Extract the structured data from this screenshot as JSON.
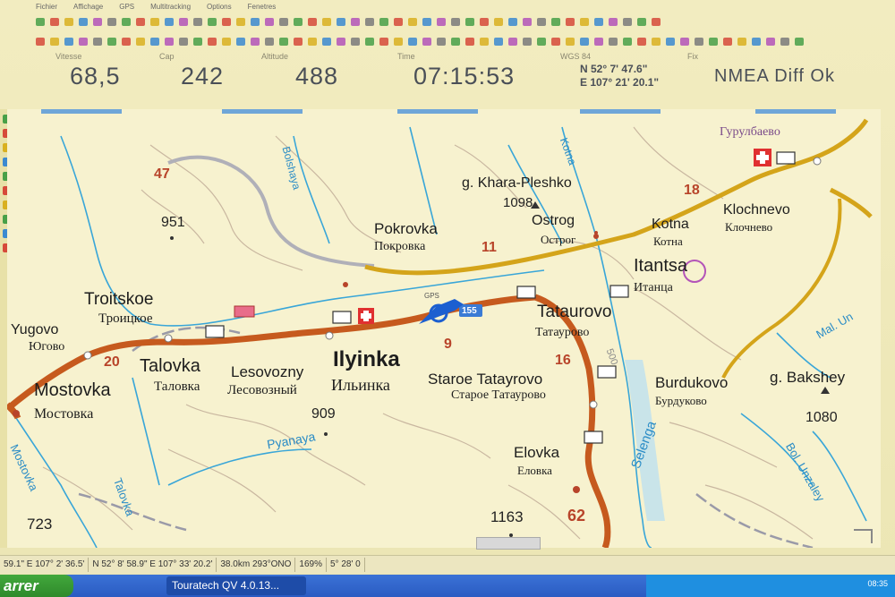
{
  "menu": [
    "Fichier",
    "Affichage",
    "GPS",
    "Multitracking",
    "Options",
    "Fenetres"
  ],
  "readouts": {
    "speed_label": "Vitesse",
    "speed": "68,5",
    "cap_label": "Cap",
    "cap": "242",
    "altitude_label": "Altitude",
    "altitude": "488",
    "time_label": "Time",
    "time": "07:15:53",
    "datum_label": "WGS 84",
    "lat": "N 52° 7' 47.6\"",
    "lon": "E 107° 21' 20.1\"",
    "fix_label": "Fix",
    "fix": "NMEA Diff Ok"
  },
  "map": {
    "places": {
      "troitskoe": "Troitskoe",
      "troitskoe_ru": "Троицкое",
      "yugovo": "Yugovo",
      "yugovo_ru": "Югово",
      "mostovka": "Mostovka",
      "mostovka_ru": "Мостовка",
      "talovka": "Talovka",
      "talovka_ru": "Таловка",
      "lesovozny": "Lesovozny",
      "lesovozny_ru": "Лесовозный",
      "ilyinka": "Ilyinka",
      "ilyinka_ru": "Ильинка",
      "staroe": "Staroe Tatayrovo",
      "staroe_ru": "Старое Татаурово",
      "tataurovo": "Tataurovo",
      "tataurovo_ru": "Татаурово",
      "pokrovka": "Pokrovka",
      "pokrovka_ru": "Покровка",
      "ostrog": "Ostrog",
      "ostrog_ru": "Острог",
      "kotna": "Kotna",
      "kotna_ru": "Котна",
      "klochnevo": "Klochnevo",
      "klochnevo_ru": "Клочнево",
      "itantsa": "Itantsa",
      "itantsa_ru": "Итанца",
      "burdukovo": "Burdukovo",
      "burdukovo_ru": "Бурдуково",
      "elovka": "Elovka",
      "elovka_ru": "Еловка",
      "khara": "g. Khara-Pleshko",
      "bakshey": "g. Bakshey",
      "gurulbaevo_ru": "Гурулбаево"
    },
    "heights": {
      "h951": "951",
      "h909": "909",
      "h1098": "1098",
      "h1080": "1080",
      "h1163": "1163",
      "h723": "723"
    },
    "road_numbers": {
      "r47": "47",
      "r20": "20",
      "r11": "11",
      "r9": "9",
      "r16": "16",
      "r18": "18",
      "r62": "62"
    },
    "rivers": {
      "selenga": "Selenga",
      "pyanaya": "Pyanaya",
      "talovka_r": "Talovka",
      "mostovka_r": "Mostovka",
      "kotna_r": "Kotna",
      "bolshaya": "Bolshaya",
      "maly": "Mal. Un",
      "bolunzaley": "Bol. Unzaley"
    },
    "gps_label": "GPS",
    "gps_badge": "155",
    "contour_500": "500"
  },
  "statusbar": {
    "s1": "59.1\"  E 107° 2' 36.5'",
    "s2": "N 52° 8' 58.9\"  E 107° 33' 20.2'",
    "s3": "38.0km 293°ONO",
    "s4": "169%",
    "s5": "5° 28' 0"
  },
  "taskbar": {
    "start": "arrer",
    "task": "Touratech QV 4.0.13...",
    "clock": "08:35"
  },
  "colors": {
    "road_main": "#c65a1e",
    "road_secondary": "#d4a41a",
    "river": "#39a6d8",
    "contour": "#c9b7a0",
    "gps_arrow": "#1c5fd0"
  }
}
